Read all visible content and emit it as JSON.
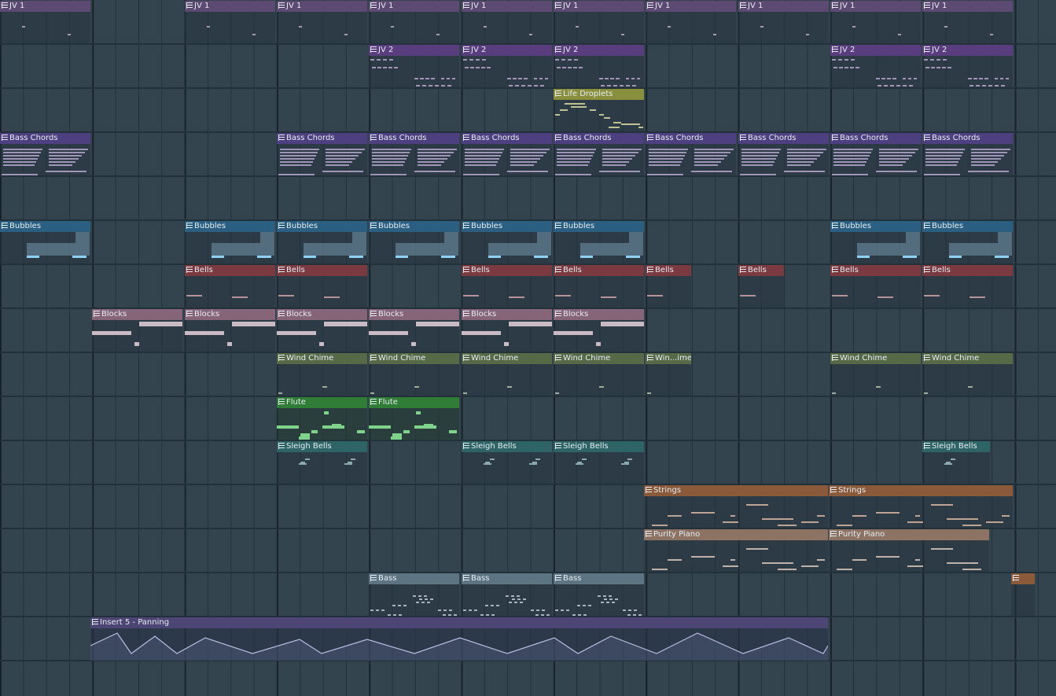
{
  "labels": {
    "jv1": "JV 1",
    "jv2": "JV 2",
    "life_droplets": "Life Droplets",
    "bass_chords": "Bass Chords",
    "bubbles": "Bubbles",
    "bells": "Bells",
    "blocks": "Blocks",
    "wind_chime": "Wind Chime",
    "wind_chime_short": "Win...ime",
    "flute": "Flute",
    "sleigh_bells": "Sleigh Bells",
    "strings": "Strings",
    "purity_piano": "Purity Piano",
    "bass": "Bass",
    "blank": "",
    "automation": "Insert 5 - Panning"
  },
  "colors": {
    "background": "#34444f",
    "jv1": "#5c4a72",
    "jv2": "#5a3d7e",
    "life_droplets": "#8a8f3e",
    "bass_chords": "#4e3f80",
    "bubbles": "#2b5f82",
    "bells": "#7a3a40",
    "blocks": "#876579",
    "wind_chime": "#566a48",
    "flute": "#2f7d36",
    "sleigh_bells": "#2e6466",
    "strings": "#8a5a3a",
    "purity_piano": "#8d7363",
    "bass": "#5d7482",
    "automation": "#4d4574"
  },
  "icons": {
    "pattern": "piano-roll-icon",
    "automation": "automation-curve-icon"
  }
}
